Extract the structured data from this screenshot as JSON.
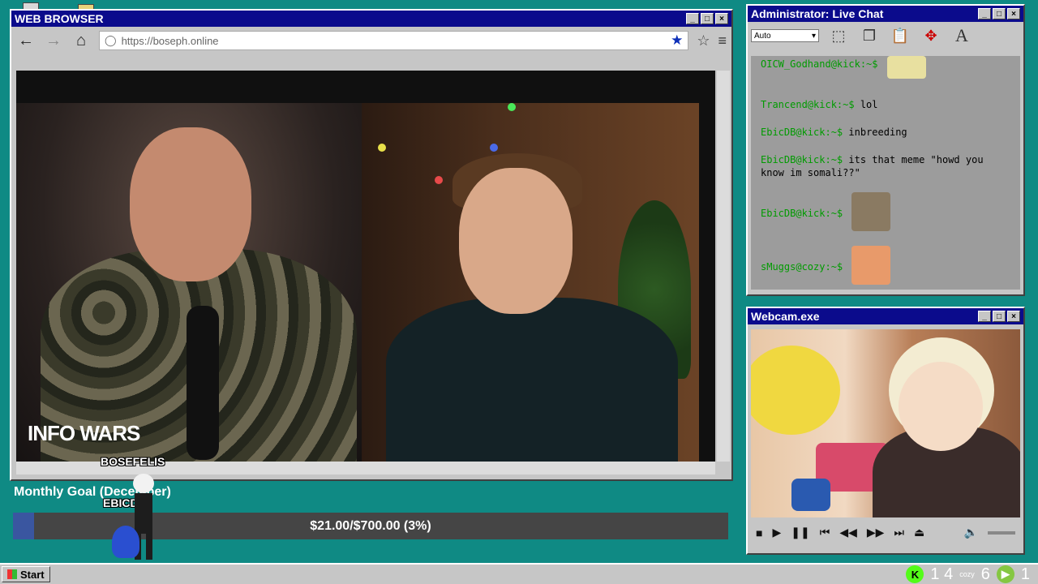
{
  "browser": {
    "title": "WEB BROWSER",
    "url": "https://boseph.online",
    "video_overlay_logo": "INFO WARS"
  },
  "chat": {
    "title": "Administrator: Live Chat",
    "font_select": "Auto",
    "messages": [
      {
        "user": "OICW_Godhand@kick:~$",
        "text": ""
      },
      {
        "user": "Trancend@kick:~$",
        "text": "lol"
      },
      {
        "user": "EbicDB@kick:~$",
        "text": "inbreeding"
      },
      {
        "user": "EbicDB@kick:~$",
        "text": "its that meme \"howd you know im somali??\""
      },
      {
        "user": "EbicDB@kick:~$",
        "text": ""
      },
      {
        "user": "sMuggs@cozy:~$",
        "text": ""
      }
    ]
  },
  "webcam": {
    "title": "Webcam.exe"
  },
  "goal": {
    "label": "Monthly Goal (December)",
    "amount_text": "$21.00/$700.00 (3%)",
    "percent": 3
  },
  "overlay_tags": {
    "tag1": "BOSEFELIS",
    "tag2": "EBICDB"
  },
  "taskbar": {
    "start_label": "Start",
    "tray_count1": "1 4",
    "tray_small": "cozy",
    "tray_count2": "6",
    "tray_count3": "1"
  },
  "colors": {
    "titlebar": "#0b0b8c",
    "desktop": "#0f8a84",
    "username": "#009b00",
    "goal_fill": "#3a56a0"
  }
}
